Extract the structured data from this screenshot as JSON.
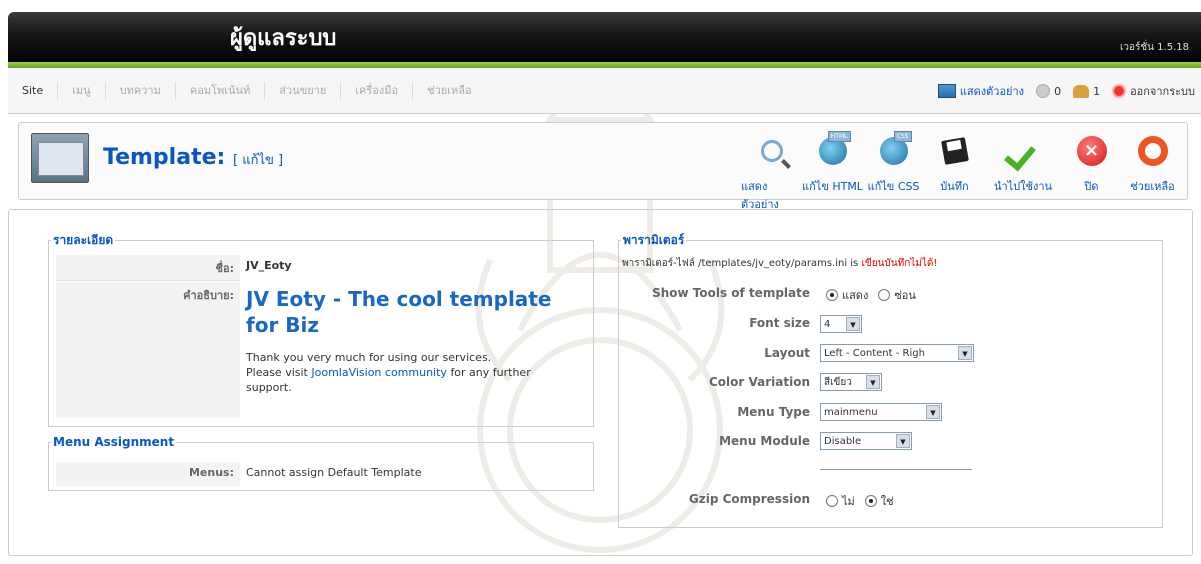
{
  "header": {
    "title": "ผู้ดูแลระบบ",
    "version": "เวอร์ชั่น 1.5.18"
  },
  "menu": {
    "items": [
      "Site",
      "เมนู",
      "บทความ",
      "คอมโพเน้นท์",
      "ส่วนขยาย",
      "เครื่องมือ",
      "ช่วยเหลือ"
    ],
    "preview": "แสดงตัวอย่าง",
    "messages_count": "0",
    "users_count": "1",
    "logout": "ออกจากระบบ"
  },
  "toolbar": {
    "title": "Template:",
    "subtitle": "[ แก้ไข ]",
    "buttons": [
      "แสดงตัวอย่าง",
      "แก้ไข HTML",
      "แก้ไข CSS",
      "บันทึก",
      "นำไปใช้งาน",
      "ปิด",
      "ช่วยเหลือ"
    ],
    "html_tag": "HTML",
    "css_tag": "CSS"
  },
  "details": {
    "legend": "รายละเอียด",
    "name_label": "ชื่อ:",
    "name_value": "JV_Eoty",
    "desc_label": "คำอธิบาย:",
    "desc_title": "JV Eoty - The cool template for Biz",
    "desc_text_1": "Thank you very much for using our services.",
    "desc_text_2_pre": "Please visit",
    "desc_link": "JoomlaVision community",
    "desc_text_2_post": "for any further support."
  },
  "menu_assignment": {
    "legend": "Menu Assignment",
    "label": "Menus:",
    "value": "Cannot assign Default Template"
  },
  "params": {
    "legend": "พารามิเตอร์",
    "note_pre": "พารามิเตอร์-ไฟล์ /templates/jv_eoty/params.ini is",
    "note_err": "เขียนบันทึกไม่ได้!",
    "show_tools_label": "Show Tools of template",
    "show_tools_opt1": "แสดง",
    "show_tools_opt2": "ซ่อน",
    "font_size_label": "Font size",
    "font_size_value": "4",
    "layout_label": "Layout",
    "layout_value": "Left - Content - Righ",
    "color_label": "Color Variation",
    "color_value": "สีเขียว",
    "menu_type_label": "Menu Type",
    "menu_type_value": "mainmenu",
    "menu_module_label": "Menu Module",
    "menu_module_value": "Disable",
    "gzip_label": "Gzip Compression",
    "gzip_opt1": "ไม่",
    "gzip_opt2": "ใช่"
  }
}
